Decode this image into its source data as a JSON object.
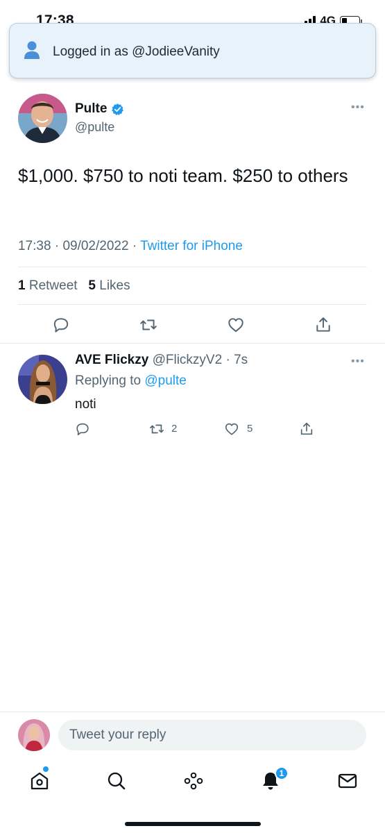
{
  "status_bar": {
    "time": "17:38",
    "network": "4G",
    "battery_level": 0.3
  },
  "banner": {
    "text": "Logged in as @JodieeVanity",
    "icon": "person-icon"
  },
  "tweet": {
    "author_name": "Pulte",
    "author_handle": "@pulte",
    "verified": true,
    "text": "$1,000. $750 to noti team. $250 to others",
    "time": "17:38",
    "date": "09/02/2022",
    "source": "Twitter for iPhone",
    "retweet_count": "1",
    "retweet_label": "Retweet",
    "like_count": "5",
    "like_label": "Likes"
  },
  "reply": {
    "author_name": "AVE Flickzy",
    "author_handle": "@FlickzyV2",
    "time": "7s",
    "replying_prefix": "Replying to",
    "replying_to": "@pulte",
    "text": "noti",
    "retweet_count": "2",
    "like_count": "5"
  },
  "compose": {
    "placeholder": "Tweet your reply"
  },
  "tab_bar": {
    "notifications_badge": "1"
  },
  "colors": {
    "accent": "#1d9bf0",
    "muted": "#536471",
    "banner_bg": "#e7f2fb"
  }
}
